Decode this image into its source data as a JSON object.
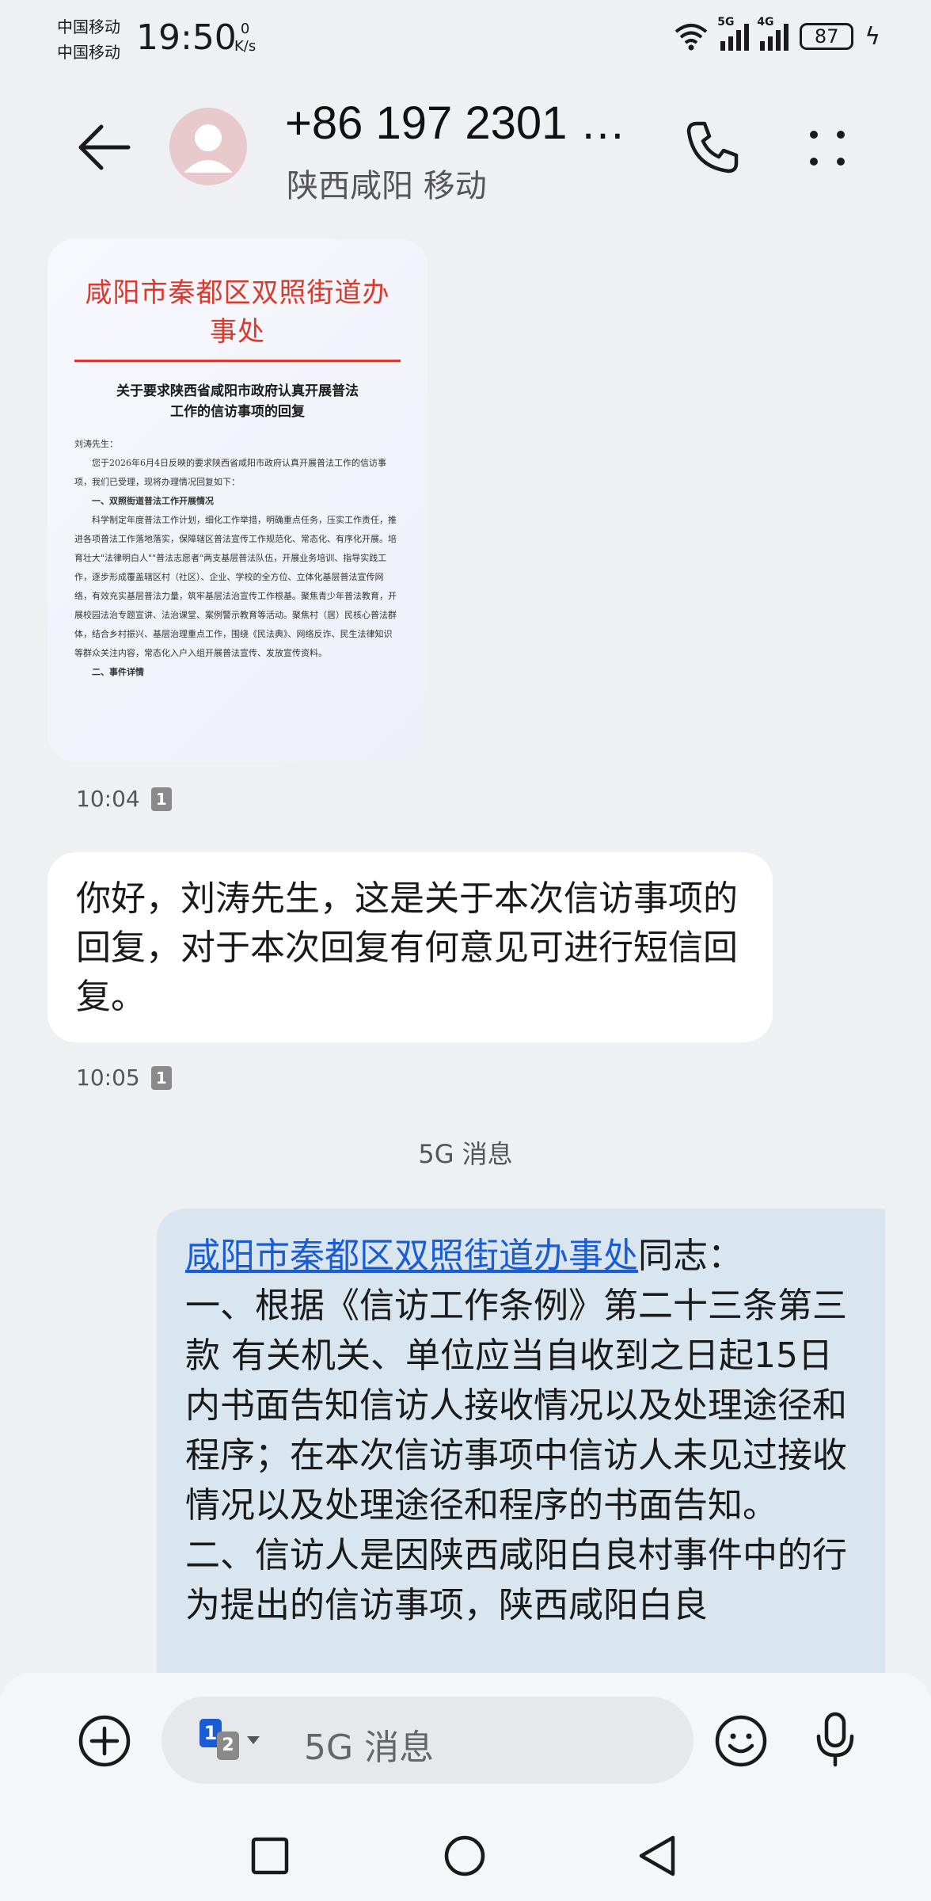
{
  "status_bar": {
    "carrier_1": "中国移动",
    "carrier_2": "中国移动",
    "time": "19:50",
    "net_speed_value": "0",
    "net_speed_unit": "K/s",
    "signal_1_label": "5G",
    "signal_2_label": "4G",
    "battery": "87"
  },
  "header": {
    "contact": "+86 197 2301 …",
    "location": "陕西咸阳 移动"
  },
  "messages": [
    {
      "type": "image",
      "doc_header": "咸阳市秦都区双照街道办事处",
      "doc_title_line1": "关于要求陕西省咸阳市政府认真开展普法",
      "doc_title_line2": "工作的信访事项的回复",
      "doc_greeting": "刘涛先生：",
      "doc_para1": "您于2026年6月4日反映的要求陕西省咸阳市政府认真开展普法工作的信访事项，我们已受理，现将办理情况回复如下：",
      "doc_section1": "一、双照街道普法工作开展情况",
      "doc_para2": "科学制定年度普法工作计划，细化工作举措，明确重点任务，压实工作责任，推进各项普法工作落地落实，保障辖区普法宣传工作规范化、常态化、有序化开展。培育壮大\"法律明白人\"\"普法志愿者\"两支基层普法队伍，开展业务培训、指导实践工作，逐步形成覆盖辖区村（社区）、企业、学校的全方位、立体化基层普法宣传网络，有效充实基层普法力量，筑牢基层法治宣传工作根基。聚焦青少年普法教育，开展校园法治专题宣讲、法治课堂、案例警示教育等活动。聚焦村（居）民核心普法群体，结合乡村振兴、基层治理重点工作，围绕《民法典》、网络反诈、民生法律知识等群众关注内容，常态化入户入组开展普法宣传、发放宣传资料。",
      "doc_section2": "二、事件详情",
      "time": "10:04",
      "sim": "1"
    },
    {
      "type": "text",
      "text": "你好，刘涛先生，这是关于本次信访事项的回复，对于本次回复有何意见可进行短信回复。",
      "time": "10:05",
      "sim": "1"
    }
  ],
  "divider": "5G 消息",
  "rcs_message": {
    "link": "咸阳市秦都区双照街道办事处",
    "after_link": "同志：",
    "body": "一、根据《信访工作条例》第二十三条第三款 有关机关、单位应当自收到之日起15日内书面告知信访人接收情况以及处理途径和程序；在本次信访事项中信访人未见过接收情况以及处理途径和程序的书面告知。\n二、信访人是因陕西咸阳白良村事件中的行为提出的信访事项，陕西咸阳白良"
  },
  "input": {
    "sim_primary": "1",
    "sim_secondary": "2",
    "placeholder": "5G 消息"
  },
  "colors": {
    "background": "#eef0f3",
    "incoming_bubble": "#ffffff",
    "rcs_bubble": "#d9e6f0",
    "link": "#1a5bd6",
    "sim_badge": "#8a8a8a",
    "doc_red": "#d83a2e",
    "sim_blue": "#1a5bd6"
  },
  "icons": [
    "back-arrow-icon",
    "avatar-person-icon",
    "phone-icon",
    "more-dots-icon",
    "add-circle-icon",
    "sim-switch-icon",
    "emoji-icon",
    "microphone-icon",
    "recents-square-icon",
    "home-circle-icon",
    "back-triangle-icon"
  ]
}
